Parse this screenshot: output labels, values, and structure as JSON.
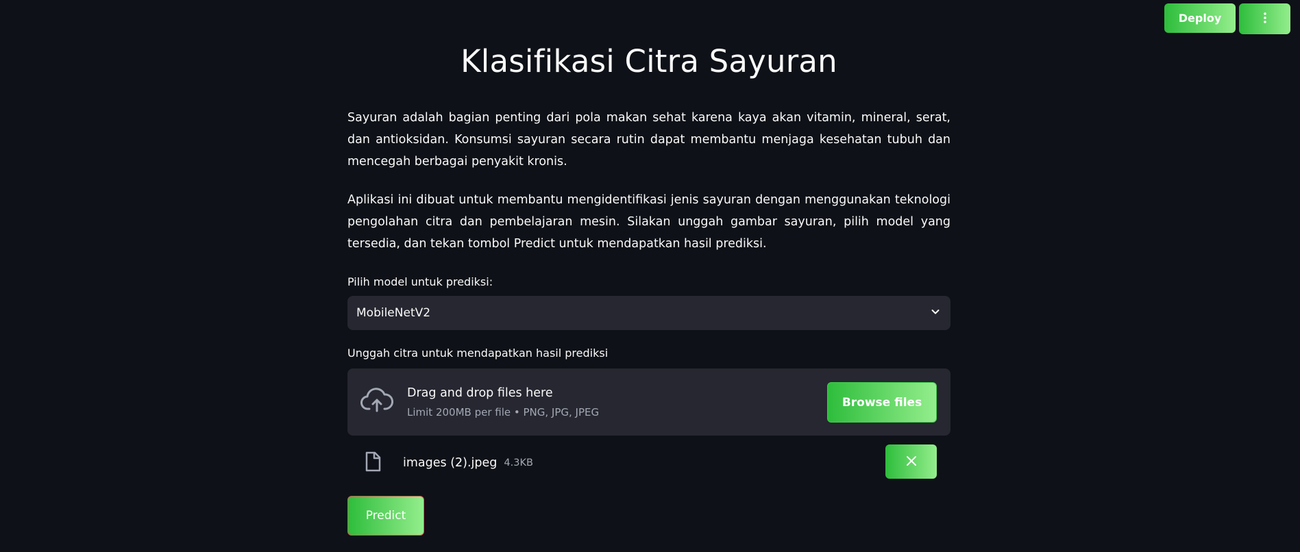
{
  "toolbar": {
    "deploy_label": "Deploy",
    "menu_icon": "vertical-dots-icon"
  },
  "page": {
    "title": "Klasifikasi Citra Sayuran",
    "paragraph1": "Sayuran adalah bagian penting dari pola makan sehat karena kaya akan vitamin, mineral, serat, dan antioksidan. Konsumsi sayuran secara rutin dapat membantu menjaga kesehatan tubuh dan mencegah berbagai penyakit kronis.",
    "paragraph2": "Aplikasi ini dibuat untuk membantu mengidentifikasi jenis sayuran dengan menggunakan teknologi pengolahan citra dan pembelajaran mesin. Silakan unggah gambar sayuran, pilih model yang tersedia, dan tekan tombol Predict untuk mendapatkan hasil prediksi."
  },
  "model_select": {
    "label": "Pilih model untuk prediksi:",
    "value": "MobileNetV2"
  },
  "uploader": {
    "label": "Unggah citra untuk mendapatkan hasil prediksi",
    "drop_title": "Drag and drop files here",
    "drop_subtitle": "Limit 200MB per file • PNG, JPG, JPEG",
    "browse_label": "Browse files",
    "file": {
      "name": "images (2).jpeg",
      "size": "4.3KB"
    }
  },
  "predict_label": "Predict",
  "colors": {
    "background": "#0e1117",
    "surface": "#262730",
    "accent_start": "#2ebd3c",
    "accent_end": "#94ee8c",
    "predict_border": "#e0555a",
    "muted_text": "#a3a8b4"
  }
}
